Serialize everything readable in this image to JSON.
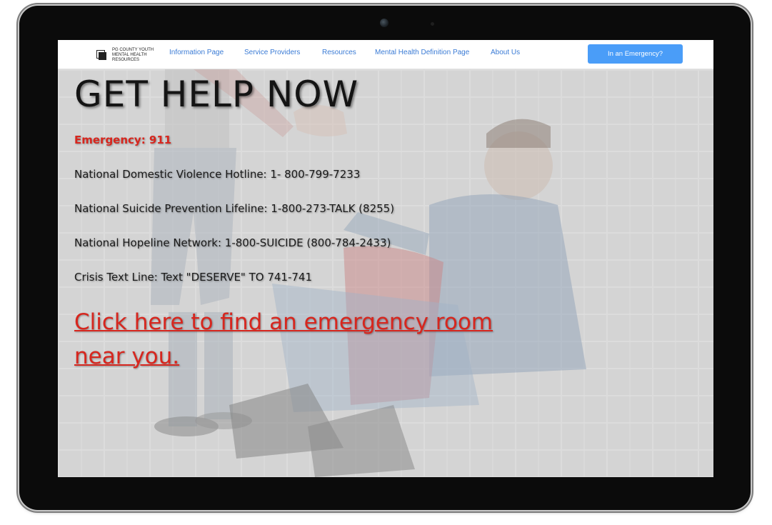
{
  "brand": {
    "logo_text": "PG COUNTY YOUTH MENTAL HEALTH RESOURCES"
  },
  "nav": {
    "items": [
      {
        "label": "Information Page"
      },
      {
        "label": "Service Providers"
      },
      {
        "label": "Resources"
      },
      {
        "label": "Mental Health Definition Page"
      },
      {
        "label": "About Us"
      }
    ],
    "emergency_button": "In an Emergency?"
  },
  "hero": {
    "headline": "GET HELP NOW",
    "emergency": "Emergency: 911",
    "hotlines": [
      {
        "text": "National Domestic Violence Hotline: 1- 800-799-7233"
      },
      {
        "text": "National Suicide Prevention Lifeline: 1-800-273-TALK (8255)"
      },
      {
        "text": "National Hopeline Network: 1-800-SUICIDE (800-784-2433)"
      },
      {
        "text": "Crisis Text Line: Text \"DESERVE\" TO 741-741"
      }
    ],
    "er_link": "Click here to find an emergency room near you."
  },
  "colors": {
    "accent": "#4a9df8",
    "link": "#3a7bd5",
    "alert": "#d7261e"
  }
}
